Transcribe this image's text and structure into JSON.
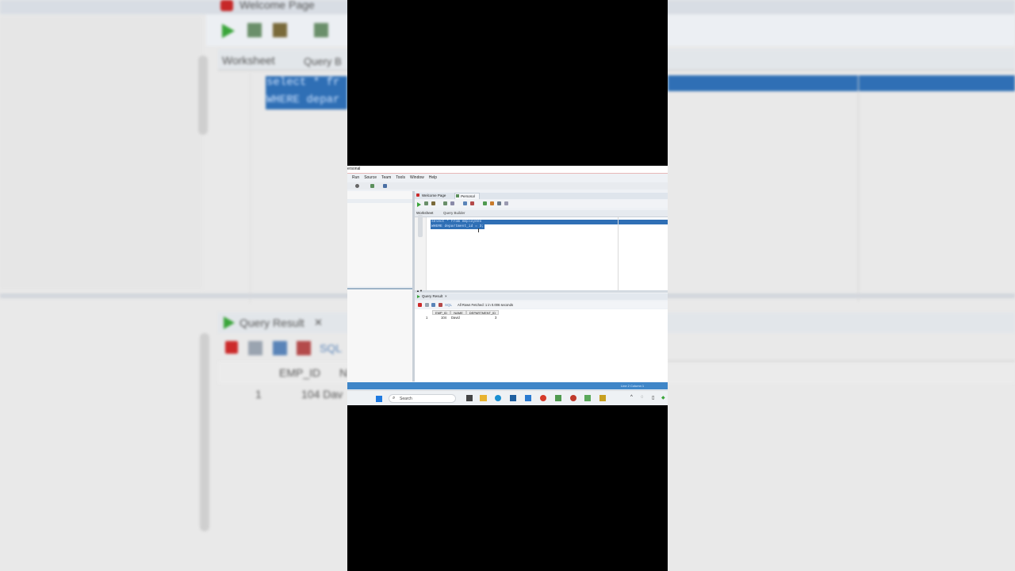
{
  "background": {
    "tab_welcome": "Welcome Page",
    "tab_worksheet": "Worksheet",
    "tab_query_builder": "Query B",
    "code_line_1": "select * fr",
    "code_line_2": "WHERE depar",
    "result_title": "Query Result",
    "sql_label": "SQL",
    "col_emp_id": "EMP_ID",
    "col_name_partial": "N",
    "row_num": "1",
    "row_value": "104 Dav"
  },
  "window": {
    "title": "ersonal",
    "menu": [
      "Run",
      "Source",
      "Team",
      "Tools",
      "Window",
      "Help"
    ]
  },
  "doc_tabs": [
    {
      "label": "Welcome Page"
    },
    {
      "label": "Personal"
    }
  ],
  "editor": {
    "tab_worksheet": "Worksheet",
    "tab_query_builder": "Query Builder",
    "code_line_1": "select * from employees",
    "code_line_2": "WHERE department_id = 3;"
  },
  "result": {
    "tab_label": "Query Result",
    "sql_label": "SQL",
    "status": "All Rows Fetched: 1 in 0.006 seconds",
    "columns": [
      "EMP_ID",
      "NAME",
      "DEPARTMENT_ID"
    ],
    "rows": [
      {
        "num": "1",
        "emp_id": "104",
        "name": "David",
        "department_id": "3"
      }
    ]
  },
  "statusbar": {
    "position": "Line 2 Column 1"
  },
  "taskbar": {
    "search_placeholder": "Search"
  },
  "colors": {
    "selection": "#2f6fb5",
    "statusbar": "#3f86c8",
    "accent_red": "#cc2a2a",
    "run_green": "#3aa53a"
  }
}
